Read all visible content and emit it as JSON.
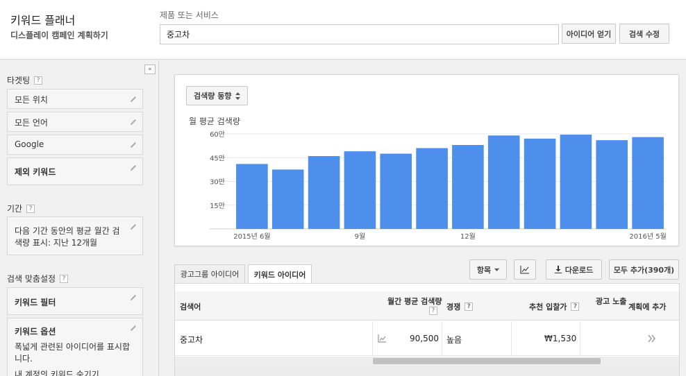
{
  "header": {
    "title": "키워드 플래너",
    "subtitle": "디스플레이 캠페인 계획하기",
    "search_label": "제품 또는 서비스",
    "search_value": "중고차",
    "get_ideas_label": "아이디어 얻기",
    "edit_search_label": "검색 수정"
  },
  "sidebar": {
    "collapse_icon": "«",
    "targeting_title": "타겟팅",
    "targeting_items": [
      "모든 위치",
      "모든 언어",
      "Google",
      "제외 키워드"
    ],
    "period_title": "기간",
    "period_text": "다음 기간 동안의 평균 월간 검색량 표시: 지난 12개월",
    "match_title": "검색 맞춤설정",
    "keyword_filter": "키워드 필터",
    "keyword_options_title": "키워드 옵션",
    "keyword_options_text": "폭넓게 관련된 아이디어를 표시합니다.",
    "keyword_options_text2": "내 계정의 키워드 숨기기",
    "help": "?"
  },
  "chart_card": {
    "dropdown_label": "검색량 동향",
    "title": "월 평균 검색량"
  },
  "chart_data": {
    "type": "bar",
    "categories": [
      "2015년 6월",
      "2015년 7월",
      "2015년 8월",
      "9월",
      "2015년 10월",
      "2015년 11월",
      "12월",
      "2016년 1월",
      "2016년 2월",
      "2016년 3월",
      "2016년 4월",
      "2016년 5월"
    ],
    "values": [
      410000,
      375000,
      460000,
      490000,
      475000,
      510000,
      530000,
      590000,
      570000,
      595000,
      560000,
      580000
    ],
    "x_tick_labels": [
      {
        "index": 0,
        "text": "2015년 6월"
      },
      {
        "index": 3,
        "text": "9월"
      },
      {
        "index": 6,
        "text": "12월"
      },
      {
        "index": 11,
        "text": "2016년 5월"
      }
    ],
    "y_ticks": [
      {
        "value": 150000,
        "label": "15만"
      },
      {
        "value": 300000,
        "label": "30만"
      },
      {
        "value": 450000,
        "label": "45만"
      },
      {
        "value": 600000,
        "label": "60만"
      }
    ],
    "ylim": [
      0,
      600000
    ],
    "grid": true,
    "color": "#4d8fea"
  },
  "tabs": [
    {
      "label": "광고그룹 아이디어",
      "active": false
    },
    {
      "label": "키워드 아이디어",
      "active": true
    }
  ],
  "toolbar": {
    "columns_label": "항목",
    "chart_icon": "line-chart-icon",
    "download_label": "다운로드",
    "add_all_label": "모두 추가(390개)"
  },
  "table": {
    "headers": {
      "keyword": "검색어",
      "monthly_volume": "월간 평균 검색량",
      "competition": "경쟁",
      "suggested_bid": "추천 입찰가",
      "impression_share": "광고 노출",
      "add_to_plan": "계획에 추가"
    },
    "rows": [
      {
        "keyword": "중고차",
        "volume": "90,500",
        "competition": "높음",
        "bid": "₩1,530"
      }
    ]
  }
}
